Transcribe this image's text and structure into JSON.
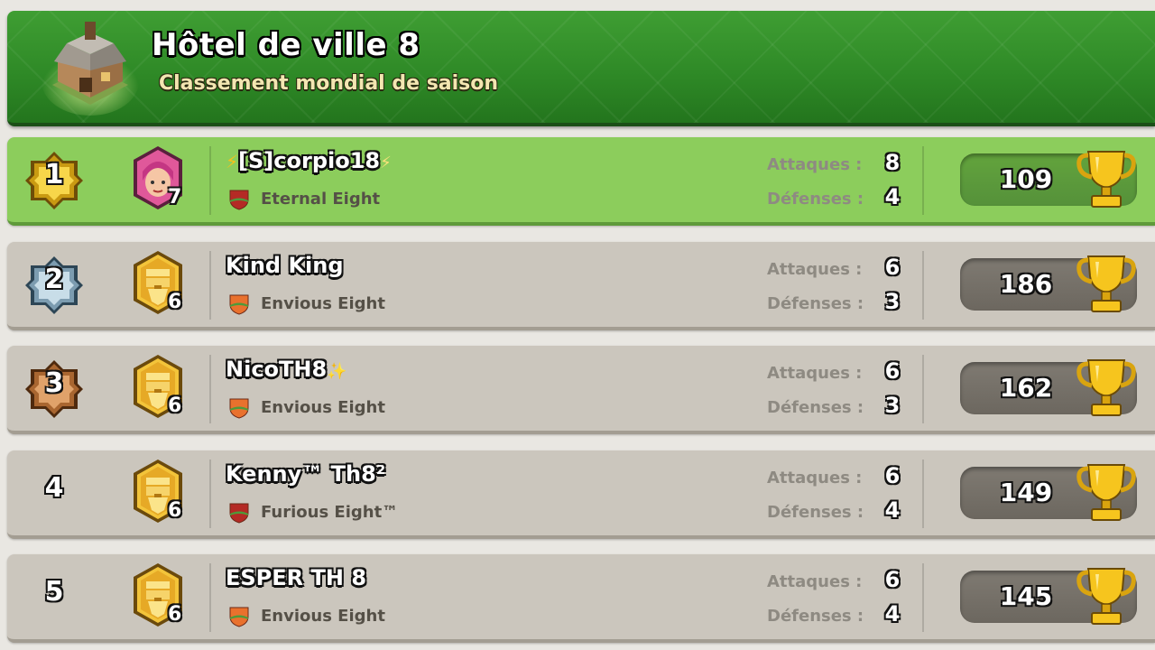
{
  "header": {
    "title": "Hôtel de ville 8",
    "subtitle": "Classement mondial de saison"
  },
  "labels": {
    "attacks": "Attaques :",
    "defenses": "Défenses :"
  },
  "players": [
    {
      "rank": "1",
      "rank_style": "gold",
      "league_icon": "archer-queen-icon",
      "level": "7",
      "name_prefix": "⚡",
      "name": "[S]corpio18",
      "name_suffix": "⚡",
      "clan": "Eternal Eight",
      "clan_color": "#b42a25",
      "attacks": "8",
      "defenses": "4",
      "trophies": "109",
      "highlight": true
    },
    {
      "rank": "2",
      "rank_style": "silver",
      "league_icon": "barbarian-king-icon",
      "level": "6",
      "name_prefix": "",
      "name": "Kind King",
      "name_suffix": "",
      "clan": "Envious Eight",
      "clan_color": "#e9712d",
      "attacks": "6",
      "defenses": "3",
      "trophies": "186",
      "highlight": false
    },
    {
      "rank": "3",
      "rank_style": "bronze",
      "league_icon": "barbarian-king-icon",
      "level": "6",
      "name_prefix": "",
      "name": "NicoTH8",
      "name_suffix": "✨",
      "clan": "Envious Eight",
      "clan_color": "#e9712d",
      "attacks": "6",
      "defenses": "3",
      "trophies": "162",
      "highlight": false
    },
    {
      "rank": "4",
      "rank_style": "plain",
      "league_icon": "barbarian-king-icon",
      "level": "6",
      "name_prefix": "",
      "name": "Kenny™ Th8²",
      "name_suffix": "",
      "clan": "Furious Eight™",
      "clan_color": "#b42a25",
      "attacks": "6",
      "defenses": "4",
      "trophies": "149",
      "highlight": false
    },
    {
      "rank": "5",
      "rank_style": "plain",
      "league_icon": "barbarian-king-icon",
      "level": "6",
      "name_prefix": "",
      "name": "ESPER TH 8",
      "name_suffix": "",
      "clan": "Envious Eight",
      "clan_color": "#e9712d",
      "attacks": "6",
      "defenses": "4",
      "trophies": "145",
      "highlight": false
    }
  ]
}
